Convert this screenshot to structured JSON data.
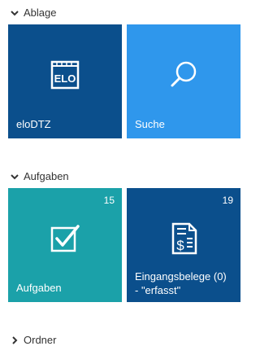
{
  "sections": [
    {
      "title": "Ablage",
      "expanded": true,
      "tiles": [
        {
          "label": "eloDTZ",
          "color": "#0b4f8c",
          "icon": "elo-logo-icon",
          "icon_text": "ELO"
        },
        {
          "label": "Suche",
          "color": "#2f97ec",
          "icon": "search-icon"
        }
      ]
    },
    {
      "title": "Aufgaben",
      "expanded": true,
      "tiles": [
        {
          "label": "Aufgaben",
          "count": "15",
          "color": "#1ba1a9",
          "icon": "checkbox-icon"
        },
        {
          "label_line1": "Eingangsbelege (0)",
          "label_line2": "- \"erfasst\"",
          "count": "19",
          "color": "#0b4f8c",
          "icon": "invoice-dollar-icon"
        }
      ]
    },
    {
      "title": "Ordner",
      "expanded": false
    }
  ]
}
